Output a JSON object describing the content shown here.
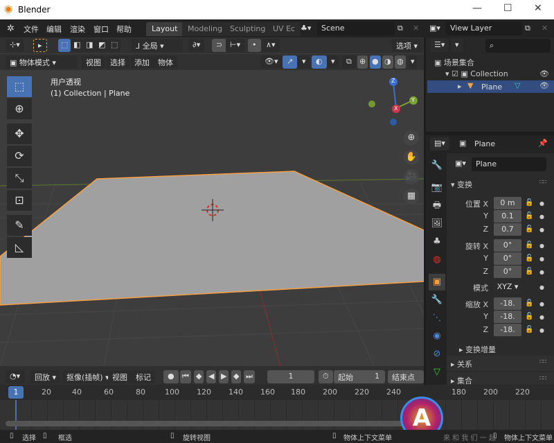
{
  "window": {
    "title": "Blender",
    "minimize": "—",
    "maximize": "☐",
    "close": "✕"
  },
  "menu": [
    "文件",
    "编辑",
    "渲染",
    "窗口",
    "帮助"
  ],
  "workspaces": [
    "Layout",
    "Modeling",
    "Sculpting",
    "UV Ec"
  ],
  "scene": "Scene",
  "view_layer": "View Layer",
  "toolbar": {
    "transform_orientation": "全局",
    "options": "选项"
  },
  "header": {
    "mode": "物体模式",
    "items": [
      "视图",
      "选择",
      "添加",
      "物体"
    ]
  },
  "viewport": {
    "view_name": "用户透视",
    "collection_info": "(1) Collection | Plane",
    "gizmo_axes": [
      "Z",
      "Y",
      "X"
    ]
  },
  "outliner": {
    "root": "场景集合",
    "collection": "Collection",
    "object": "Plane"
  },
  "properties": {
    "object_name": "Plane",
    "data_name": "Plane",
    "panel_transform": "变换",
    "location": {
      "label": "位置",
      "x": "0 m",
      "y": "0.1",
      "z": "0.7"
    },
    "rotation": {
      "label": "旋转",
      "x": "0°",
      "y": "0°",
      "z": "0°"
    },
    "mode": {
      "label": "模式",
      "value": "XYZ"
    },
    "scale": {
      "label": "缩放",
      "x": "-18.",
      "y": "-18.",
      "z": "-18."
    },
    "axes": [
      "X",
      "Y",
      "Z"
    ],
    "delta": "变换增量",
    "relations": "关系",
    "collections": "集合"
  },
  "timeline": {
    "playback": "回放",
    "keying": "抠像(插帧)",
    "view": "视图",
    "marker": "标记",
    "current_frame": "1",
    "start_label": "起始",
    "start": "1",
    "end_label": "结束点",
    "ticks": [
      "20",
      "40",
      "60",
      "80",
      "100",
      "120",
      "140",
      "160",
      "180",
      "200",
      "220",
      "240"
    ],
    "ticks_right": [
      "180",
      "200",
      "220"
    ],
    "playhead": "1"
  },
  "status": {
    "select": "选择",
    "box_select": "框选",
    "rotate_view": "旋转视图",
    "context_menu": "物体上下文菜单",
    "context_menu2": "物体上下文菜单",
    "watermark": "来 和 我 们 一 起"
  },
  "colors": {
    "accent": "#4772b3",
    "selection": "#f5a142",
    "viewport_bg": "#3d3d3d"
  }
}
